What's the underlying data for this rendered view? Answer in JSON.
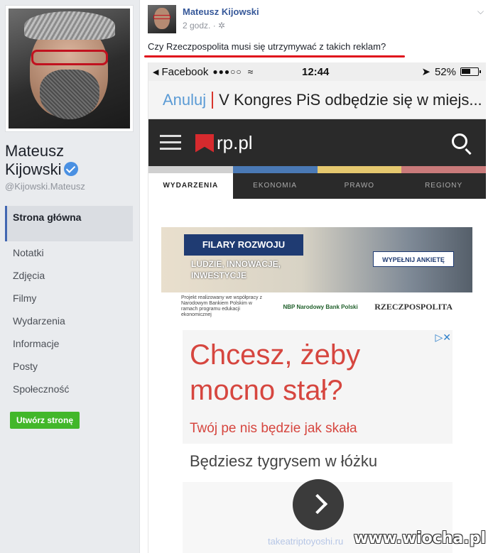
{
  "profile": {
    "name_line1": "Mateusz",
    "name_line2": "Kijowski",
    "handle": "@Kijowski.Mateusz"
  },
  "sidebar": {
    "items": [
      {
        "label": "Strona główna",
        "active": true
      },
      {
        "label": "Notatki"
      },
      {
        "label": "Zdjęcia"
      },
      {
        "label": "Filmy"
      },
      {
        "label": "Wydarzenia"
      },
      {
        "label": "Informacje"
      },
      {
        "label": "Posty"
      },
      {
        "label": "Społeczność"
      }
    ],
    "create_button": "Utwórz stronę"
  },
  "post": {
    "author": "Mateusz Kijowski",
    "time": "2 godz. · ✲",
    "text": "Czy Rzeczpospolita musi się utrzymywać z takich reklam?"
  },
  "phone": {
    "status": {
      "app": "Facebook",
      "signal": "●●●○○",
      "time": "12:44",
      "battery": "52%"
    },
    "search": {
      "cancel": "Anuluj",
      "query": "V Kongres PiS odbędzie się w miejs..."
    },
    "site_logo": "rp.pl",
    "tabs": [
      "WYDARZENIA",
      "EKONOMIA",
      "PRAWO",
      "REGIONY"
    ],
    "banner": {
      "title": "FILARY ROZWOJU",
      "subtitle": "LUDZIE, INNOWACJE, INWESTYCJE",
      "cta": "WYPEŁNIJ ANKIETĘ",
      "footer_left": "Projekt realizowany we współpracy z Narodowym Bankiem Polskim w ramach programu edukacji ekonomicznej",
      "nbp": "NBP Narodowy Bank Polski",
      "rzecz": "RZECZPOSPOLITA"
    },
    "ad": {
      "headline": "Chcesz, żeby mocno stał?",
      "sub": "Twój pe nis będzie jak skała",
      "line": "Będziesz tygrysem w łóżku",
      "url": "takeatriptoyoshi.ru",
      "adchoices": "▷✕"
    }
  },
  "watermark": "www.wiocha.pl",
  "colors": {
    "accent": "#365899",
    "underline": "#e0111c",
    "ad_red": "#d6463f"
  }
}
